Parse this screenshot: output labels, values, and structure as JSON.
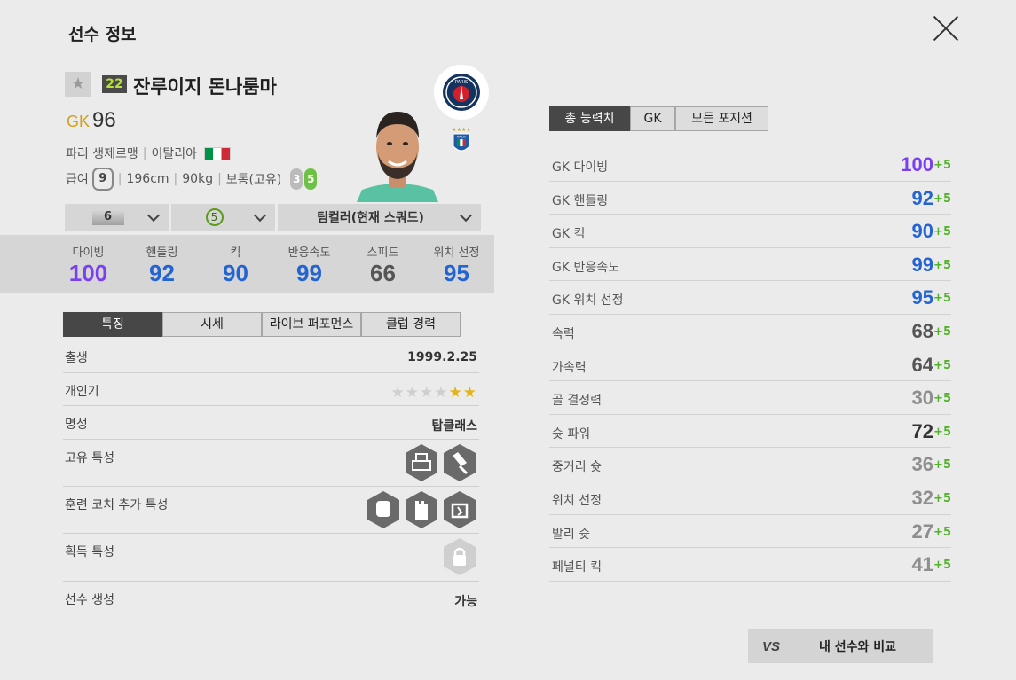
{
  "panel": {
    "title": "선수 정보"
  },
  "player": {
    "season_badge": "22",
    "name": "잔루이지 돈나룸마",
    "position": "GK",
    "overall": "96",
    "club": "파리 생제르맹",
    "nation": "이탈리아",
    "wage_label": "급여",
    "wage": "9",
    "height": "196cm",
    "weight": "90kg",
    "body_type": "보통(고유)",
    "weak_foot": "3",
    "strong_foot": "5"
  },
  "selectors": {
    "enhance": "6",
    "level": "5",
    "team_color": "팀컬러(현재 스쿼드)"
  },
  "summary_stats": [
    {
      "label": "다이빙",
      "value": "100",
      "color": "#7a3ff0"
    },
    {
      "label": "핸들링",
      "value": "92",
      "color": "#2364d2"
    },
    {
      "label": "킥",
      "value": "90",
      "color": "#2364d2"
    },
    {
      "label": "반응속도",
      "value": "99",
      "color": "#2364d2"
    },
    {
      "label": "스피드",
      "value": "66",
      "color": "#555555"
    },
    {
      "label": "위치 선정",
      "value": "95",
      "color": "#2364d2"
    }
  ],
  "info_tabs": [
    "특징",
    "시세",
    "라이브 퍼포먼스",
    "클럽 경력"
  ],
  "traits": {
    "birth_label": "출생",
    "birth": "1999.2.25",
    "popularity_label": "개인기",
    "popularity_stars": "★★★★★★",
    "fame_label": "명성",
    "fame": "탑클래스",
    "unique_label": "고유 특성",
    "coach_label": "훈련 코치 추가 특성",
    "acquired_label": "획득 특성",
    "create_label": "선수 생성",
    "create": "가능"
  },
  "stat_tabs": [
    "총 능력치",
    "GK",
    "모든 포지션"
  ],
  "attributes": [
    {
      "name": "GK 다이빙",
      "value": "100",
      "plus": "+5",
      "color": "#7a3ff0"
    },
    {
      "name": "GK 핸들링",
      "value": "92",
      "plus": "+5",
      "color": "#2364d2"
    },
    {
      "name": "GK 킥",
      "value": "90",
      "plus": "+5",
      "color": "#2364d2"
    },
    {
      "name": "GK 반응속도",
      "value": "99",
      "plus": "+5",
      "color": "#2364d2"
    },
    {
      "name": "GK 위치 선정",
      "value": "95",
      "plus": "+5",
      "color": "#2364d2"
    },
    {
      "name": "속력",
      "value": "68",
      "plus": "+5",
      "color": "#555555"
    },
    {
      "name": "가속력",
      "value": "64",
      "plus": "+5",
      "color": "#555555"
    },
    {
      "name": "골 결정력",
      "value": "30",
      "plus": "+5",
      "color": "#8e8e8e"
    },
    {
      "name": "슛 파워",
      "value": "72",
      "plus": "+5",
      "color": "#333333"
    },
    {
      "name": "중거리 슛",
      "value": "36",
      "plus": "+5",
      "color": "#8e8e8e"
    },
    {
      "name": "위치 선정",
      "value": "32",
      "plus": "+5",
      "color": "#8e8e8e"
    },
    {
      "name": "발리 슛",
      "value": "27",
      "plus": "+5",
      "color": "#8e8e8e"
    },
    {
      "name": "페널티 킥",
      "value": "41",
      "plus": "+5",
      "color": "#8e8e8e"
    }
  ],
  "compare": {
    "vs": "VS",
    "label": "내 선수와 비교"
  },
  "icons": {
    "close": "close-icon",
    "favorite": "star-icon",
    "club": "psg-crest-icon",
    "nation": "italy-crest-icon",
    "lock": "lock-icon"
  },
  "logo_text": {
    "club": "PARIS",
    "nation": "ITALIA"
  }
}
